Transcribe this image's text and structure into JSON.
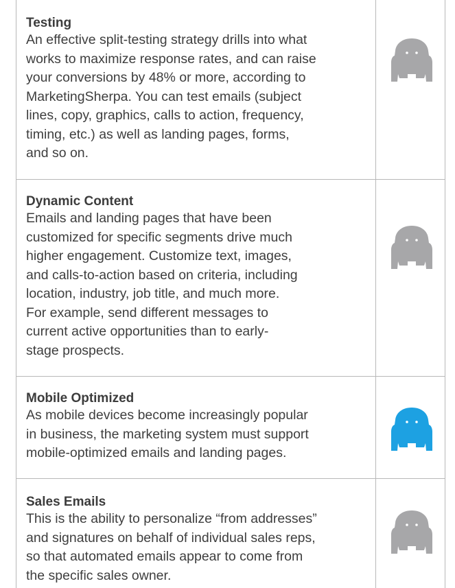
{
  "rows": [
    {
      "title": "Testing",
      "lines": [
        "An effective split-testing strategy drills into what",
        "works to maximize response rates, and can raise",
        "your conversions by 48% or more, according to",
        "MarketingSherpa. You can test emails (subject",
        "lines, copy, graphics, calls to action, frequency,",
        "timing, etc.) as well as landing pages, forms,",
        "and so on."
      ],
      "icon": "ghost-icon",
      "icon_color": "#a7a7a9"
    },
    {
      "title": "Dynamic Content",
      "lines": [
        "Emails and landing pages that have been",
        "customized for specific segments drive much",
        "higher engagement. Customize text, images,",
        "and calls-to-action based on criteria, including",
        "location, industry, job title, and much more.",
        "For example, send different messages to",
        "current active opportunities than to early-",
        "stage prospects."
      ],
      "icon": "ghost-icon",
      "icon_color": "#a7a7a9"
    },
    {
      "title": "Mobile Optimized",
      "lines": [
        "As mobile devices become increasingly popular",
        "in business, the marketing system must support",
        "mobile-optimized emails and landing pages."
      ],
      "icon": "ghost-icon",
      "icon_color": "#1da1e2"
    },
    {
      "title": "Sales Emails",
      "lines": [
        "This is the ability to personalize “from addresses”",
        "and signatures on behalf of individual sales reps,",
        "so that automated emails appear to come from",
        "the specific sales owner."
      ],
      "icon": "ghost-icon",
      "icon_color": "#a7a7a9"
    }
  ]
}
